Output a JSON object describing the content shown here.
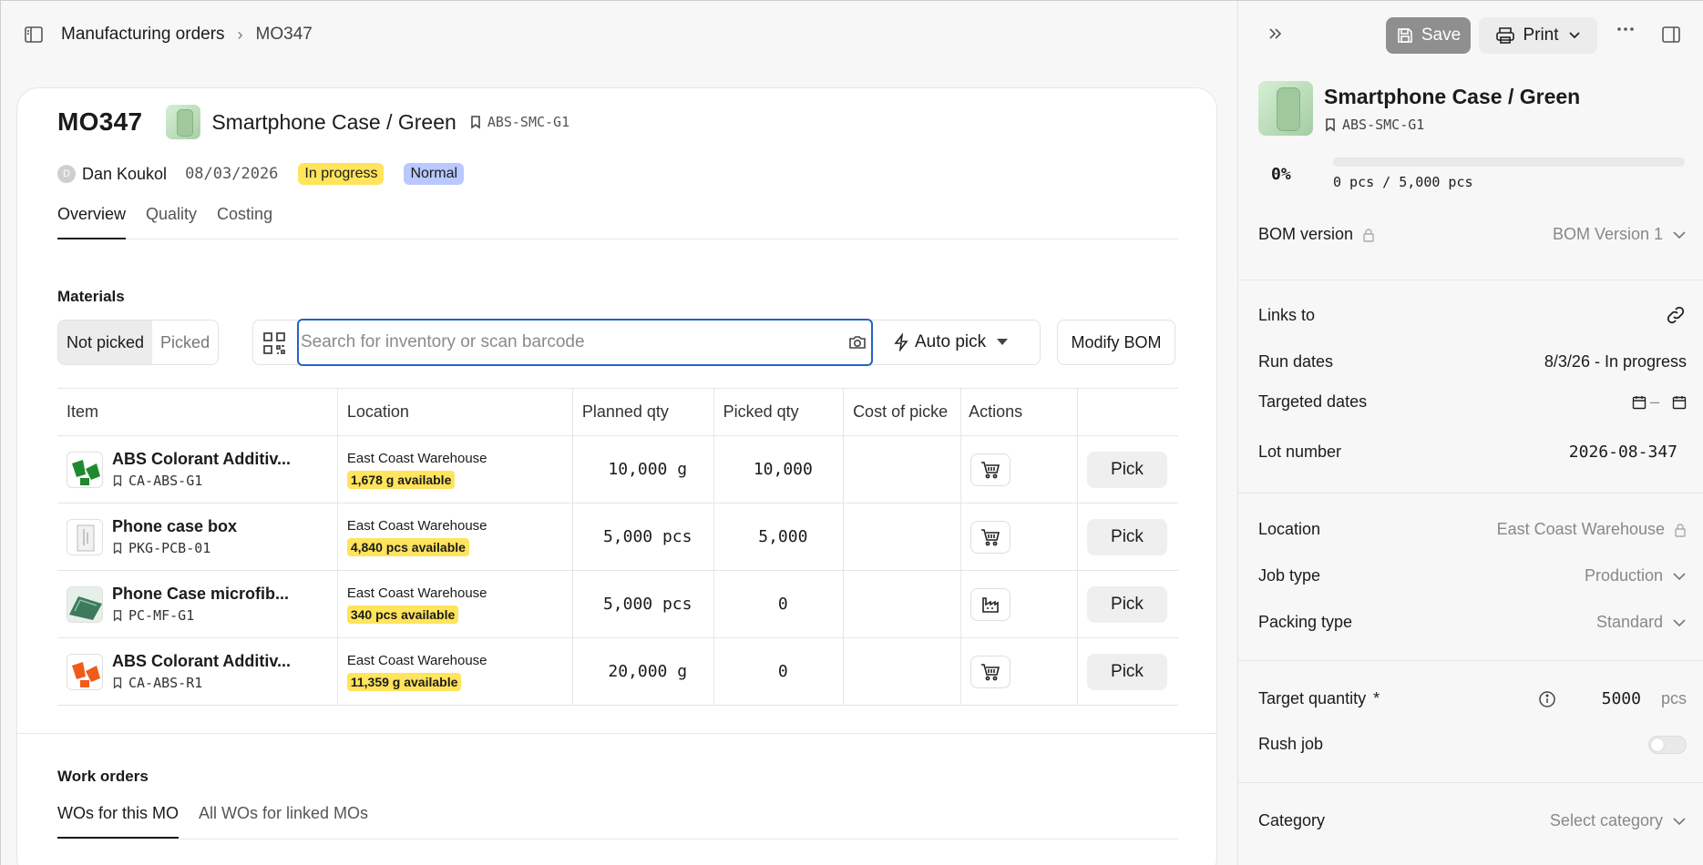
{
  "breadcrumb": {
    "parent": "Manufacturing orders",
    "separator": "›",
    "current": "MO347"
  },
  "order": {
    "id": "MO347",
    "product_name": "Smartphone Case / Green",
    "product_sku": "ABS-SMC-G1",
    "owner_initial": "D",
    "owner": "Dan Koukol",
    "date": "08/03/2026",
    "status": "In progress",
    "priority": "Normal"
  },
  "tabs": [
    "Overview",
    "Quality",
    "Costing"
  ],
  "materials": {
    "title": "Materials",
    "segments": [
      "Not picked",
      "Picked"
    ],
    "search_placeholder": "Search for inventory or scan barcode",
    "auto_pick_label": "Auto pick",
    "modify_bom_label": "Modify BOM",
    "columns": [
      "Item",
      "Location",
      "Planned qty",
      "Picked qty",
      "Cost of picke",
      "Actions",
      ""
    ],
    "rows": [
      {
        "name": "ABS Colorant Additiv...",
        "sku": "CA-ABS-G1",
        "location": "East Coast Warehouse",
        "available": "1,678 g available",
        "planned": "10,000 g",
        "picked": "10,000",
        "action_icon": "cart-icon",
        "pick_label": "Pick"
      },
      {
        "name": "Phone case box",
        "sku": "PKG-PCB-01",
        "location": "East Coast Warehouse",
        "available": "4,840 pcs available",
        "planned": "5,000 pcs",
        "picked": "5,000",
        "action_icon": "cart-icon",
        "pick_label": "Pick"
      },
      {
        "name": "Phone Case microfib...",
        "sku": "PC-MF-G1",
        "location": "East Coast Warehouse",
        "available": "340 pcs available",
        "planned": "5,000 pcs",
        "picked": "0",
        "action_icon": "factory-icon",
        "pick_label": "Pick"
      },
      {
        "name": "ABS Colorant Additiv...",
        "sku": "CA-ABS-R1",
        "location": "East Coast Warehouse",
        "available": "11,359 g available",
        "planned": "20,000 g",
        "picked": "0",
        "action_icon": "cart-icon",
        "pick_label": "Pick"
      }
    ]
  },
  "work_orders": {
    "title": "Work orders",
    "tabs": [
      "WOs for this MO",
      "All WOs for linked MOs"
    ]
  },
  "panel": {
    "save_label": "Save",
    "print_label": "Print",
    "product_name": "Smartphone Case / Green",
    "product_sku": "ABS-SMC-G1",
    "progress_pct": "0%",
    "progress_fraction": 0,
    "progress_text": "0 pcs / 5,000 pcs",
    "bom_label": "BOM version",
    "bom_value": "BOM Version 1",
    "links_label": "Links to",
    "run_dates_label": "Run dates",
    "run_dates_value": "8/3/26 - In progress",
    "targeted_dates_label": "Targeted dates",
    "targeted_dates_sep": "–",
    "lot_label": "Lot number",
    "lot_value": "2026-08-347",
    "location_label": "Location",
    "location_value": "East Coast Warehouse",
    "job_type_label": "Job type",
    "job_type_value": "Production",
    "packing_label": "Packing type",
    "packing_value": "Standard",
    "target_qty_label": "Target quantity",
    "target_qty_required": "*",
    "target_qty_value": "5000",
    "target_qty_unit": "pcs",
    "rush_label": "Rush job",
    "rush_on": false,
    "category_label": "Category",
    "category_placeholder": "Select category"
  },
  "colors": {
    "accent": "#2463c9",
    "yellow_badge": "#ffe45c",
    "blue_badge": "#b9c8ff",
    "save_bg": "#8f8f8f"
  }
}
